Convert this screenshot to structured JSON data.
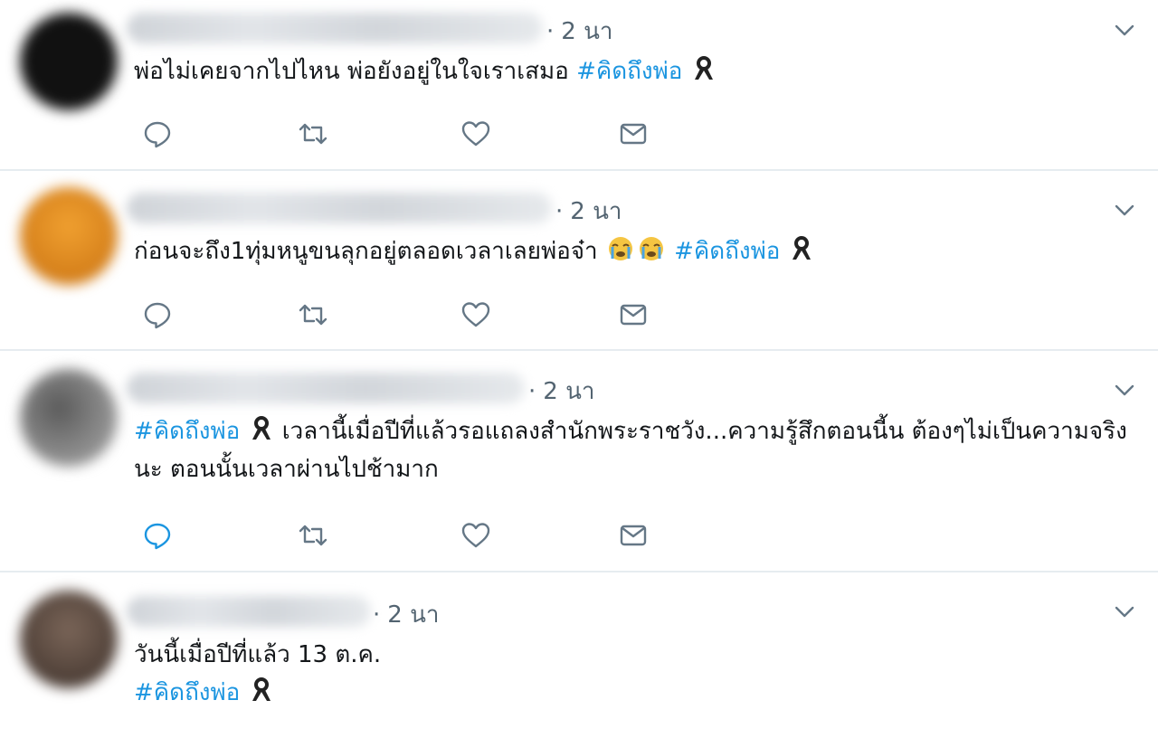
{
  "colors": {
    "hashtag": "#1b95e0",
    "icon": "#657786",
    "icon_active": "#1b95e0",
    "divider": "#e6ecf0"
  },
  "tweets": [
    {
      "time": "2 นา",
      "text_before": "พ่อไม่เคยจากไปไหน พ่อยังอยู่ในใจเราเสมอ ",
      "hashtag": "#คิดถึงพ่อ",
      "emoji": "black-ribbon-icon",
      "avatar_color": "#111111",
      "reply_active": false
    },
    {
      "time": "2 นา",
      "text_before": "ก่อนจะถึง1ทุ่มหนูขนลุกอยู่ตลอดเวลาเลยพ่อจ๋า ",
      "hashtag": "#คิดถึงพ่อ",
      "emoji": "crying-face-icon",
      "avatar_color": "#e09020",
      "reply_active": false
    },
    {
      "time": "2 นา",
      "hashtag": "#คิดถึงพ่อ",
      "text_after": " เวลานี้เมื่อปีที่แล้วรอแถลงสำนักพระราชวัง...ความรู้สึกตอนนี้น ต้องๆไม่เป็นความจริงนะ ตอนนั้นเวลาผ่านไปช้ามาก",
      "emoji": "black-ribbon-icon",
      "avatar_color": "#8a8a8a",
      "reply_active": true
    },
    {
      "time": "2 นา",
      "text_before": "วันนี้เมื่อปีที่แล้ว 13 ต.ค.",
      "hashtag": "#คิดถึงพ่อ",
      "emoji": "black-ribbon-icon",
      "avatar_color": "#5a4a40"
    }
  ]
}
